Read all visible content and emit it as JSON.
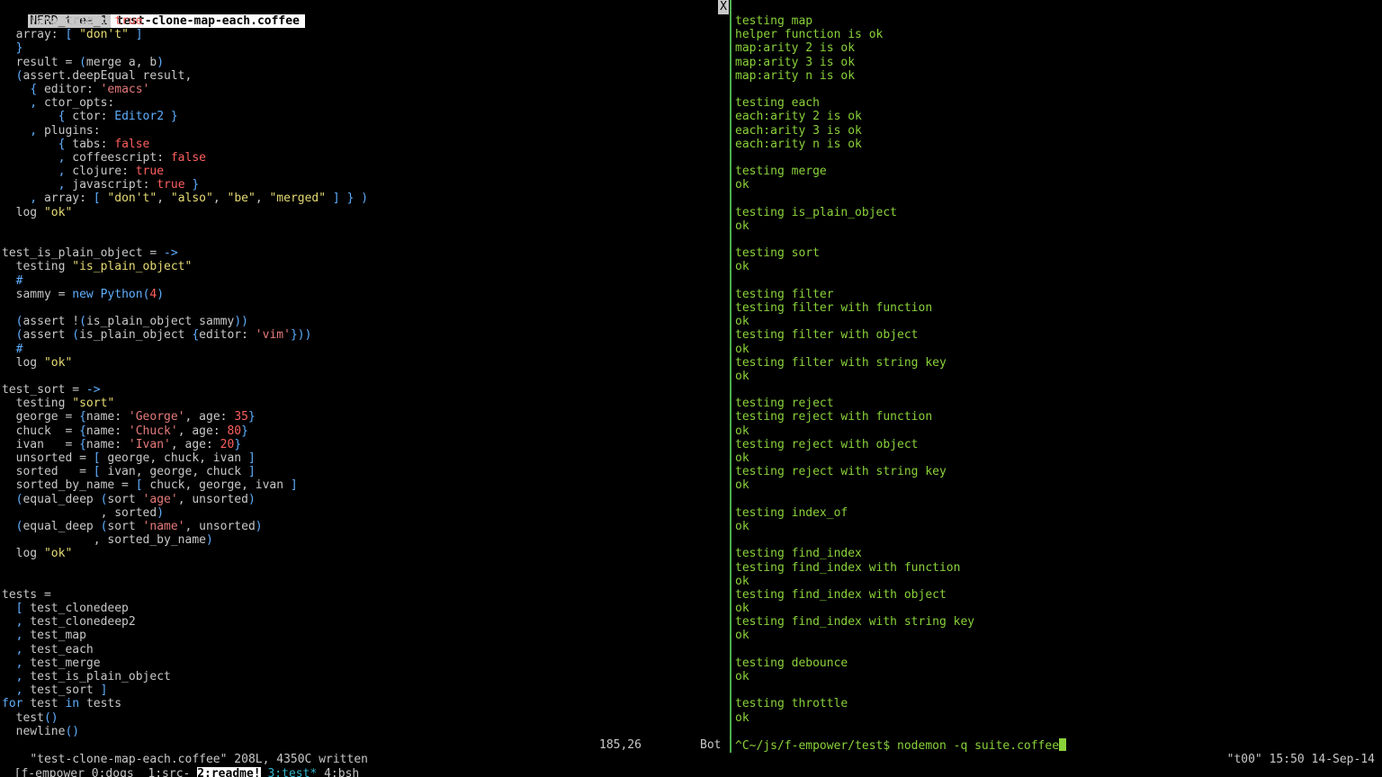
{
  "vim": {
    "tabs": [
      {
        "label": "NERD_tree_1",
        "active": false
      },
      {
        "label": "test-clone-map-each.coffee",
        "active": true
      }
    ],
    "close_label": "X",
    "code_lines": [
      [
        [
          "    ",
          "plain"
        ],
        [
          "javascript",
          "prop"
        ],
        [
          ": ",
          "plain"
        ],
        [
          "true",
          "bool"
        ]
      ],
      [
        [
          "  array: ",
          "plain"
        ],
        [
          "[ ",
          "br"
        ],
        [
          "\"don't\"",
          "str"
        ],
        [
          " ]",
          "br"
        ]
      ],
      [
        [
          "  }",
          "br"
        ]
      ],
      [
        [
          "  result = ",
          "plain"
        ],
        [
          "(",
          "br"
        ],
        [
          "merge a, b",
          "plain"
        ],
        [
          ")",
          "br"
        ]
      ],
      [
        [
          "  ",
          "plain"
        ],
        [
          "(",
          "br"
        ],
        [
          "assert.deepEqual result,",
          "plain"
        ]
      ],
      [
        [
          "    ",
          "plain"
        ],
        [
          "{ ",
          "br"
        ],
        [
          "editor",
          "prop"
        ],
        [
          ": ",
          "plain"
        ],
        [
          "'emacs'",
          "sq"
        ]
      ],
      [
        [
          "    , ",
          "br"
        ],
        [
          "ctor_opts",
          "prop"
        ],
        [
          ":",
          "plain"
        ]
      ],
      [
        [
          "        ",
          "plain"
        ],
        [
          "{ ",
          "br"
        ],
        [
          "ctor",
          "prop"
        ],
        [
          ": ",
          "plain"
        ],
        [
          "Editor2",
          "fn"
        ],
        [
          " }",
          "br"
        ]
      ],
      [
        [
          "    , ",
          "br"
        ],
        [
          "plugins",
          "prop"
        ],
        [
          ":",
          "plain"
        ]
      ],
      [
        [
          "        ",
          "plain"
        ],
        [
          "{ ",
          "br"
        ],
        [
          "tabs",
          "prop"
        ],
        [
          ": ",
          "plain"
        ],
        [
          "false",
          "bool"
        ]
      ],
      [
        [
          "        , ",
          "br"
        ],
        [
          "coffeescript",
          "prop"
        ],
        [
          ": ",
          "plain"
        ],
        [
          "false",
          "bool"
        ]
      ],
      [
        [
          "        , ",
          "br"
        ],
        [
          "clojure",
          "prop"
        ],
        [
          ": ",
          "plain"
        ],
        [
          "true",
          "bool"
        ]
      ],
      [
        [
          "        , ",
          "br"
        ],
        [
          "javascript",
          "prop"
        ],
        [
          ": ",
          "plain"
        ],
        [
          "true",
          "bool"
        ],
        [
          " }",
          "br"
        ]
      ],
      [
        [
          "    , ",
          "br"
        ],
        [
          "array",
          "prop"
        ],
        [
          ": ",
          "plain"
        ],
        [
          "[ ",
          "br"
        ],
        [
          "\"don't\"",
          "str"
        ],
        [
          ", ",
          "plain"
        ],
        [
          "\"also\"",
          "str"
        ],
        [
          ", ",
          "plain"
        ],
        [
          "\"be\"",
          "str"
        ],
        [
          ", ",
          "plain"
        ],
        [
          "\"merged\"",
          "str"
        ],
        [
          " ] } )",
          "br"
        ]
      ],
      [
        [
          "  log ",
          "plain"
        ],
        [
          "\"ok\"",
          "str"
        ]
      ],
      [],
      [],
      [
        [
          "test_is_plain_object = ",
          "plain"
        ],
        [
          "->",
          "kw"
        ]
      ],
      [
        [
          "  testing ",
          "plain"
        ],
        [
          "\"is_plain_object\"",
          "str"
        ]
      ],
      [
        [
          "  #",
          "kw"
        ]
      ],
      [
        [
          "  sammy = ",
          "plain"
        ],
        [
          "new ",
          "kw"
        ],
        [
          "Python",
          "fn"
        ],
        [
          "(",
          "br"
        ],
        [
          "4",
          "num"
        ],
        [
          ")",
          "br"
        ]
      ],
      [],
      [
        [
          "  ",
          "plain"
        ],
        [
          "(",
          "br"
        ],
        [
          "assert !",
          "plain"
        ],
        [
          "(",
          "br"
        ],
        [
          "is_plain_object sammy",
          "plain"
        ],
        [
          "))",
          "br"
        ]
      ],
      [
        [
          "  ",
          "plain"
        ],
        [
          "(",
          "br"
        ],
        [
          "assert ",
          "plain"
        ],
        [
          "(",
          "br"
        ],
        [
          "is_plain_object ",
          "plain"
        ],
        [
          "{",
          "br"
        ],
        [
          "editor",
          "prop"
        ],
        [
          ": ",
          "plain"
        ],
        [
          "'vim'",
          "sq"
        ],
        [
          "}))",
          "br"
        ]
      ],
      [
        [
          "  #",
          "kw"
        ]
      ],
      [
        [
          "  log ",
          "plain"
        ],
        [
          "\"ok\"",
          "str"
        ]
      ],
      [],
      [
        [
          "test_sort = ",
          "plain"
        ],
        [
          "->",
          "kw"
        ]
      ],
      [
        [
          "  testing ",
          "plain"
        ],
        [
          "\"sort\"",
          "str"
        ]
      ],
      [
        [
          "  george = ",
          "plain"
        ],
        [
          "{",
          "br"
        ],
        [
          "name",
          "prop"
        ],
        [
          ": ",
          "plain"
        ],
        [
          "'George'",
          "sq"
        ],
        [
          ", ",
          "plain"
        ],
        [
          "age",
          "prop"
        ],
        [
          ": ",
          "plain"
        ],
        [
          "35",
          "num"
        ],
        [
          "}",
          "br"
        ]
      ],
      [
        [
          "  chuck  = ",
          "plain"
        ],
        [
          "{",
          "br"
        ],
        [
          "name",
          "prop"
        ],
        [
          ": ",
          "plain"
        ],
        [
          "'Chuck'",
          "sq"
        ],
        [
          ", ",
          "plain"
        ],
        [
          "age",
          "prop"
        ],
        [
          ": ",
          "plain"
        ],
        [
          "80",
          "num"
        ],
        [
          "}",
          "br"
        ]
      ],
      [
        [
          "  ivan   = ",
          "plain"
        ],
        [
          "{",
          "br"
        ],
        [
          "name",
          "prop"
        ],
        [
          ": ",
          "plain"
        ],
        [
          "'Ivan'",
          "sq"
        ],
        [
          ", ",
          "plain"
        ],
        [
          "age",
          "prop"
        ],
        [
          ": ",
          "plain"
        ],
        [
          "20",
          "num"
        ],
        [
          "}",
          "br"
        ]
      ],
      [
        [
          "  unsorted = ",
          "plain"
        ],
        [
          "[ ",
          "br"
        ],
        [
          "george, chuck, ivan",
          "plain"
        ],
        [
          " ]",
          "br"
        ]
      ],
      [
        [
          "  sorted   = ",
          "plain"
        ],
        [
          "[ ",
          "br"
        ],
        [
          "ivan, george, chuck",
          "plain"
        ],
        [
          " ]",
          "br"
        ]
      ],
      [
        [
          "  sorted_by_name = ",
          "plain"
        ],
        [
          "[ ",
          "br"
        ],
        [
          "chuck, george, ivan",
          "plain"
        ],
        [
          " ]",
          "br"
        ]
      ],
      [
        [
          "  ",
          "plain"
        ],
        [
          "(",
          "br"
        ],
        [
          "equal_deep ",
          "plain"
        ],
        [
          "(",
          "br"
        ],
        [
          "sort ",
          "plain"
        ],
        [
          "'age'",
          "sq"
        ],
        [
          ", unsorted",
          "plain"
        ],
        [
          ")",
          "br"
        ]
      ],
      [
        [
          "              , sorted",
          "plain"
        ],
        [
          ")",
          "br"
        ]
      ],
      [
        [
          "  ",
          "plain"
        ],
        [
          "(",
          "br"
        ],
        [
          "equal_deep ",
          "plain"
        ],
        [
          "(",
          "br"
        ],
        [
          "sort ",
          "plain"
        ],
        [
          "'name'",
          "sq"
        ],
        [
          ", unsorted",
          "plain"
        ],
        [
          ")",
          "br"
        ]
      ],
      [
        [
          "             , sorted_by_name",
          "plain"
        ],
        [
          ")",
          "br"
        ]
      ],
      [
        [
          "  log ",
          "plain"
        ],
        [
          "\"ok\"",
          "str"
        ]
      ],
      [],
      [],
      [
        [
          "tests =",
          "plain"
        ]
      ],
      [
        [
          "  [ ",
          "br"
        ],
        [
          "test_clonedeep",
          "plain"
        ]
      ],
      [
        [
          "  , ",
          "br"
        ],
        [
          "test_clonedeep2",
          "plain"
        ]
      ],
      [
        [
          "  , ",
          "br"
        ],
        [
          "test_map",
          "plain"
        ]
      ],
      [
        [
          "  , ",
          "br"
        ],
        [
          "test_each",
          "plain"
        ]
      ],
      [
        [
          "  , ",
          "br"
        ],
        [
          "test_merge",
          "plain"
        ]
      ],
      [
        [
          "  , ",
          "br"
        ],
        [
          "test_is_plain_object",
          "plain"
        ]
      ],
      [
        [
          "  , ",
          "br"
        ],
        [
          "test_sort",
          "plain"
        ],
        [
          " ]",
          "br"
        ]
      ],
      [
        [
          "for ",
          "kw"
        ],
        [
          "test ",
          "plain"
        ],
        [
          "in ",
          "kw"
        ],
        [
          "tests",
          "plain"
        ]
      ],
      [
        [
          "  test",
          "plain"
        ],
        [
          "()",
          "br"
        ]
      ],
      [
        [
          "  newline",
          "plain"
        ],
        [
          "()",
          "br"
        ]
      ]
    ],
    "cmdline": {
      "message": "\"test-clone-map-each.coffee\" 208L, 4350C written",
      "position": "185,26",
      "scroll": "Bot"
    }
  },
  "terminal": {
    "lines": [
      "testing map",
      "helper function is ok",
      "map:arity 2 is ok",
      "map:arity 3 is ok",
      "map:arity n is ok",
      "",
      "testing each",
      "each:arity 2 is ok",
      "each:arity 3 is ok",
      "each:arity n is ok",
      "",
      "testing merge",
      "ok",
      "",
      "testing is_plain_object",
      "ok",
      "",
      "testing sort",
      "ok",
      "",
      "testing filter",
      "testing filter with function",
      "ok",
      "testing filter with object",
      "ok",
      "testing filter with string key",
      "ok",
      "",
      "testing reject",
      "testing reject with function",
      "ok",
      "testing reject with object",
      "ok",
      "testing reject with string key",
      "ok",
      "",
      "testing index_of",
      "ok",
      "",
      "testing find_index",
      "testing find_index with function",
      "ok",
      "testing find_index with object",
      "ok",
      "testing find_index with string key",
      "ok",
      "",
      "testing debounce",
      "ok",
      "",
      "testing throttle",
      "ok"
    ],
    "prompt": "^C~/js/f-empower/test$ nodemon -q suite.coffee"
  },
  "tmux": {
    "session": "[f-empower",
    "windows": [
      {
        "label": "0:dogs",
        "state": "normal"
      },
      {
        "label": "1:src-",
        "state": "normal"
      },
      {
        "label": "2:readme!",
        "state": "current"
      },
      {
        "label": "3:test*",
        "state": "last"
      },
      {
        "label": "4:bsh",
        "state": "normal"
      }
    ],
    "right": "\"t00\" 15:50 14-Sep-14"
  }
}
